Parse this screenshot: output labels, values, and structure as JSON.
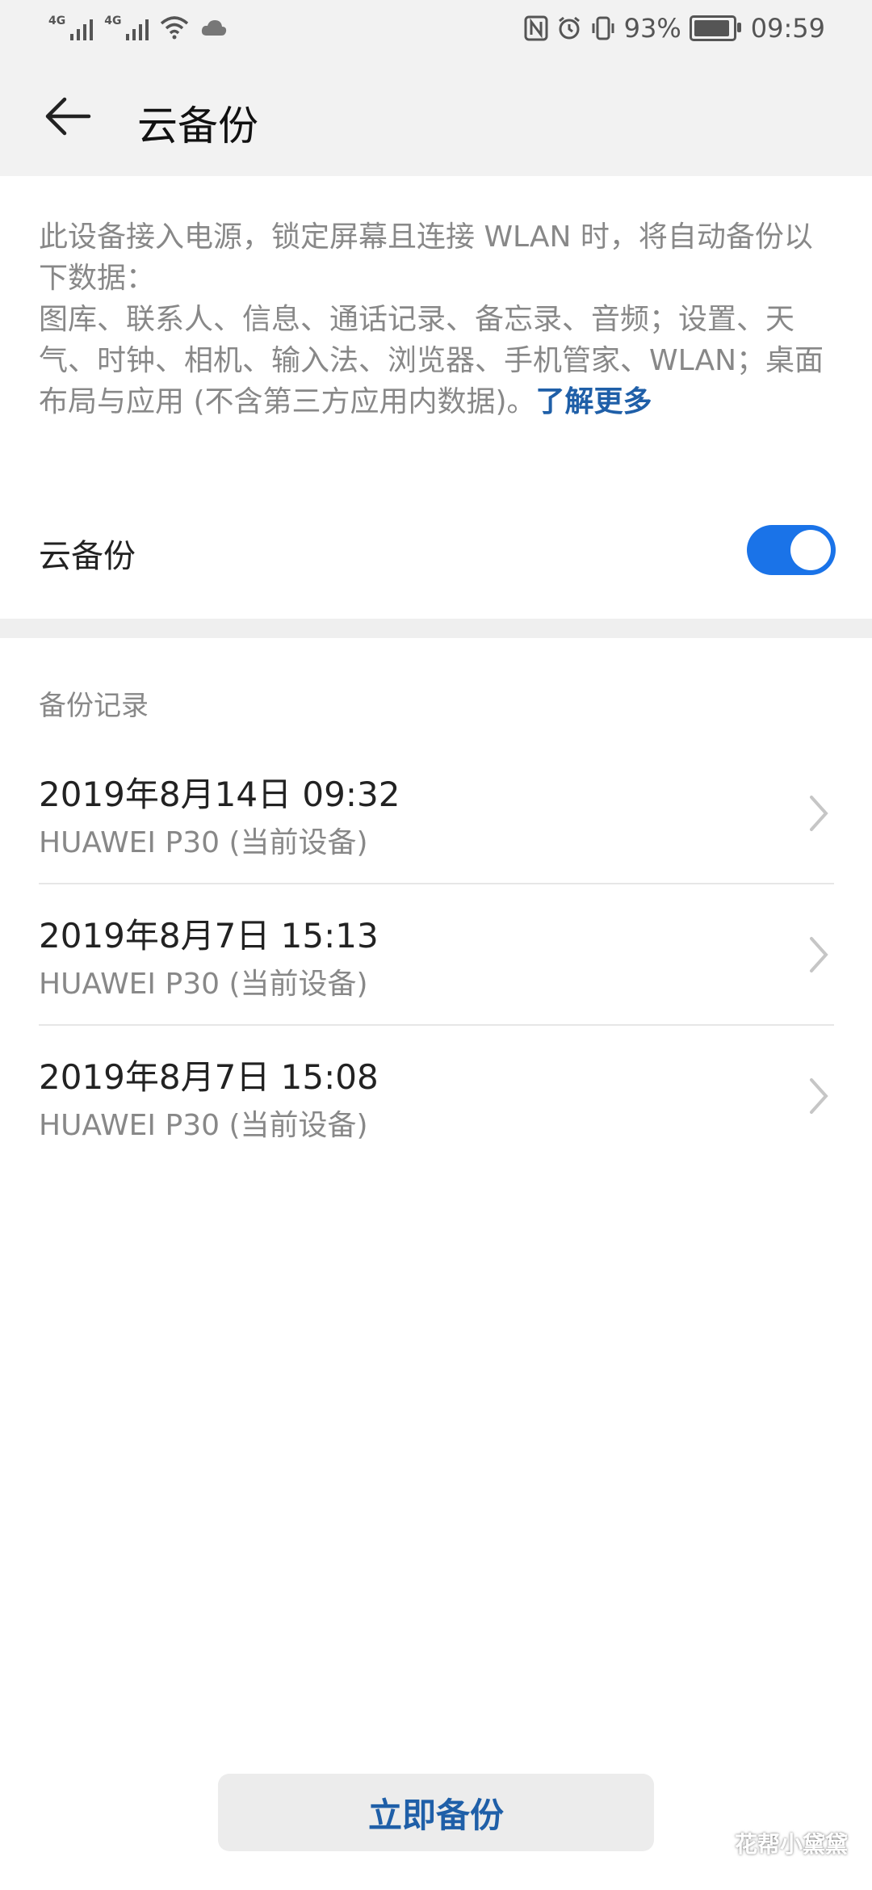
{
  "status_bar": {
    "sim1_label": "4G",
    "sim2_label": "4G",
    "battery_percent": "93%",
    "time": "09:59",
    "icons": [
      "signal-icon",
      "wifi-icon",
      "cloud-icon",
      "nfc-icon",
      "alarm-icon",
      "vibrate-icon",
      "battery-icon"
    ]
  },
  "header": {
    "title": "云备份"
  },
  "description": {
    "text": "此设备接入电源，锁定屏幕且连接 WLAN 时，将自动备份以下数据：\n图库、联系人、信息、通话记录、备忘录、音频；设置、天气、时钟、相机、输入法、浏览器、手机管家、WLAN；桌面布局与应用 (不含第三方应用内数据)。",
    "link": "了解更多"
  },
  "toggle": {
    "label": "云备份",
    "on": true
  },
  "records": {
    "title": "备份记录",
    "items": [
      {
        "date": "2019年8月14日 09:32",
        "device": "HUAWEI P30 (当前设备)"
      },
      {
        "date": "2019年8月7日 15:13",
        "device": "HUAWEI P30 (当前设备)"
      },
      {
        "date": "2019年8月7日 15:08",
        "device": "HUAWEI P30 (当前设备)"
      }
    ]
  },
  "actions": {
    "backup_now": "立即备份"
  },
  "watermark": {
    "text": "花帮小黛黛"
  },
  "colors": {
    "accent": "#1a73e8",
    "link": "#1f5fa8",
    "secondary_text": "#888888",
    "header_bg": "#f2f2f2"
  }
}
